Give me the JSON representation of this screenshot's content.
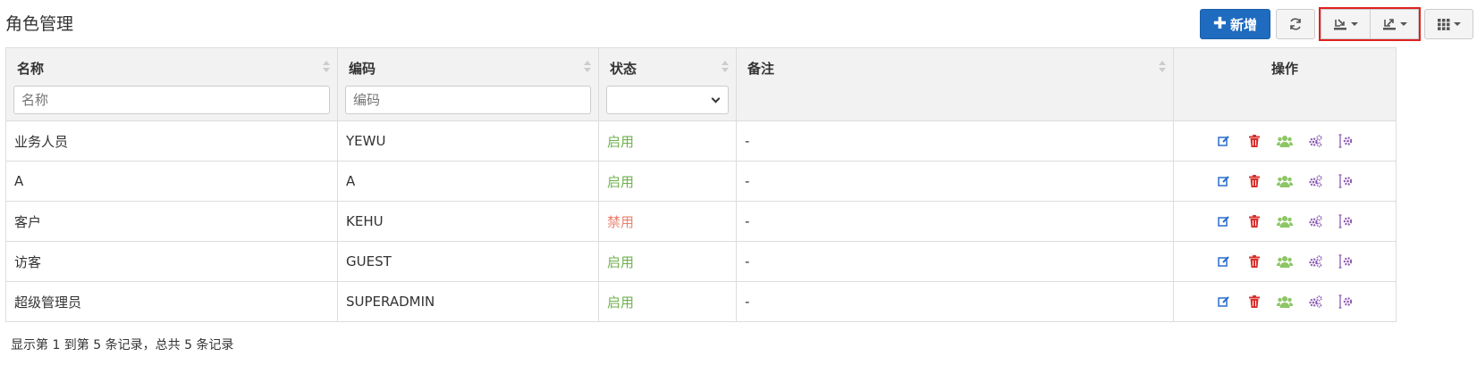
{
  "page": {
    "title": "角色管理"
  },
  "toolbar": {
    "add_label": "新增",
    "refresh_icon": "refresh-icon",
    "export_icon": "export-icon",
    "columns_icon": "columns-grid-icon"
  },
  "table": {
    "columns": [
      {
        "label": "名称",
        "filter_placeholder": "名称"
      },
      {
        "label": "编码",
        "filter_placeholder": "编码"
      },
      {
        "label": "状态"
      },
      {
        "label": "备注"
      },
      {
        "label": "操作"
      }
    ],
    "rows": [
      {
        "name": "业务人员",
        "code": "YEWU",
        "status": "启用",
        "remark": "-"
      },
      {
        "name": "A",
        "code": "A",
        "status": "启用",
        "remark": "-"
      },
      {
        "name": "客户",
        "code": "KEHU",
        "status": "禁用",
        "remark": "-"
      },
      {
        "name": "访客",
        "code": "GUEST",
        "status": "启用",
        "remark": "-"
      },
      {
        "name": "超级管理员",
        "code": "SUPERADMIN",
        "status": "启用",
        "remark": "-"
      }
    ]
  },
  "footer": {
    "info": "显示第 1 到第 5 条记录，总共 5 条记录"
  },
  "colors": {
    "primary": "#1e6bbf",
    "enabled": "#6fb04f",
    "disabled": "#e8816f",
    "edit": "#2a6fc9",
    "delete": "#d9302c",
    "users": "#8cc665",
    "perm": "#8b5bb5"
  }
}
